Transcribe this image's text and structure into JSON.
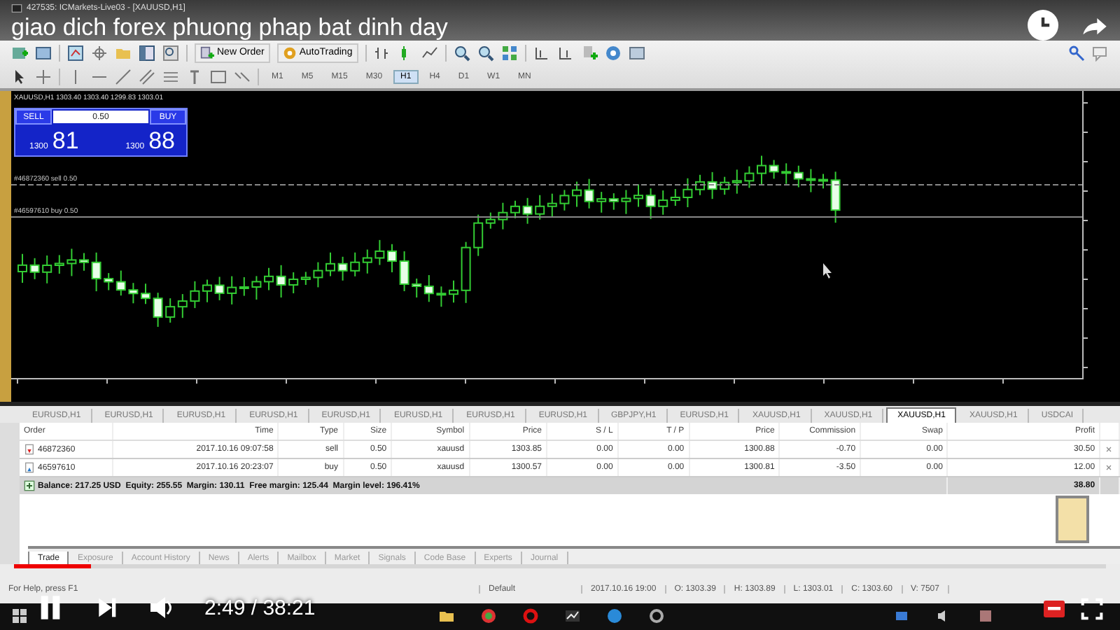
{
  "window": {
    "title": "427535: ICMarkets-Live03 - [XAUUSD,H1]"
  },
  "video": {
    "title": "giao dich forex phuong phap bat dinh day",
    "time": "2:49 / 38:21",
    "level": 0.07
  },
  "toolbar": {
    "buttons": [
      {
        "label": "New Order"
      },
      {
        "label": "AutoTrading"
      }
    ],
    "timeframes": [
      {
        "label": "M1",
        "selected": false
      },
      {
        "label": "M5",
        "selected": false
      },
      {
        "label": "M15",
        "selected": false
      },
      {
        "label": "M30",
        "selected": false
      },
      {
        "label": "H1",
        "selected": true
      },
      {
        "label": "H4",
        "selected": false
      },
      {
        "label": "D1",
        "selected": false
      },
      {
        "label": "W1",
        "selected": false
      },
      {
        "label": "MN",
        "selected": false
      }
    ]
  },
  "chart": {
    "symbol_info": "XAUUSD,H1 1303.40 1303.40 1299.83 1303.01",
    "one_click": {
      "sell": "SELL",
      "buy": "BUY",
      "lot": "0.50",
      "sell_small": "1300",
      "sell_big": "81",
      "buy_small": "1300",
      "buy_big": "88"
    },
    "order_lines": [
      {
        "label": "#46872360 sell 0.50",
        "kind": "sell"
      },
      {
        "label": "#46597610 buy 0.50",
        "kind": "buy"
      }
    ]
  },
  "chart_tabs": [
    {
      "label": "EURUSD,H1",
      "selected": false
    },
    {
      "label": "EURUSD,H1",
      "selected": false
    },
    {
      "label": "EURUSD,H1",
      "selected": false
    },
    {
      "label": "EURUSD,H1",
      "selected": false
    },
    {
      "label": "EURUSD,H1",
      "selected": false
    },
    {
      "label": "EURUSD,H1",
      "selected": false
    },
    {
      "label": "EURUSD,H1",
      "selected": false
    },
    {
      "label": "EURUSD,H1",
      "selected": false
    },
    {
      "label": "GBPJPY,H1",
      "selected": false
    },
    {
      "label": "EURUSD,H1",
      "selected": false
    },
    {
      "label": "XAUUSD,H1",
      "selected": false
    },
    {
      "label": "XAUUSD,H1",
      "selected": false
    },
    {
      "label": "XAUUSD,H1",
      "selected": true
    },
    {
      "label": "XAUUSD,H1",
      "selected": false
    },
    {
      "label": "USDCAI",
      "selected": false
    }
  ],
  "trade_table": {
    "columns": [
      "Order",
      "Time",
      "Type",
      "Size",
      "Symbol",
      "Price",
      "S / L",
      "T / P",
      "Price",
      "Commission",
      "Swap",
      "Profit"
    ],
    "rows": [
      {
        "kind": "sell",
        "cells": [
          "46872360",
          "2017.10.16 09:07:58",
          "sell",
          "0.50",
          "xauusd",
          "1303.85",
          "0.00",
          "0.00",
          "1300.88",
          "-0.70",
          "0.00",
          "30.50"
        ]
      },
      {
        "kind": "buy",
        "cells": [
          "46597610",
          "2017.10.16 20:23:07",
          "buy",
          "0.50",
          "xauusd",
          "1300.57",
          "0.00",
          "0.00",
          "1300.81",
          "-3.50",
          "0.00",
          "12.00"
        ]
      }
    ],
    "summary": {
      "text": "Balance: 217.25 USD  Equity: 255.55  Margin: 130.11  Free margin: 125.44  Margin level: 196.41%",
      "profit": "38.80"
    }
  },
  "terminal_tabs": [
    {
      "label": "Trade",
      "selected": true
    },
    {
      "label": "Exposure",
      "selected": false
    },
    {
      "label": "Account History",
      "selected": false
    },
    {
      "label": "News",
      "selected": false
    },
    {
      "label": "Alerts",
      "selected": false
    },
    {
      "label": "Mailbox",
      "selected": false
    },
    {
      "label": "Market",
      "selected": false
    },
    {
      "label": "Signals",
      "selected": false
    },
    {
      "label": "Code Base",
      "selected": false
    },
    {
      "label": "Experts",
      "selected": false
    },
    {
      "label": "Journal",
      "selected": false
    }
  ],
  "status_bar": [
    "For Help, press F1",
    "Default",
    "2017.10.16 19:00",
    "O: 1303.39",
    "H: 1303.89",
    "L: 1303.01",
    "C: 1303.60",
    "V: 7507"
  ]
}
